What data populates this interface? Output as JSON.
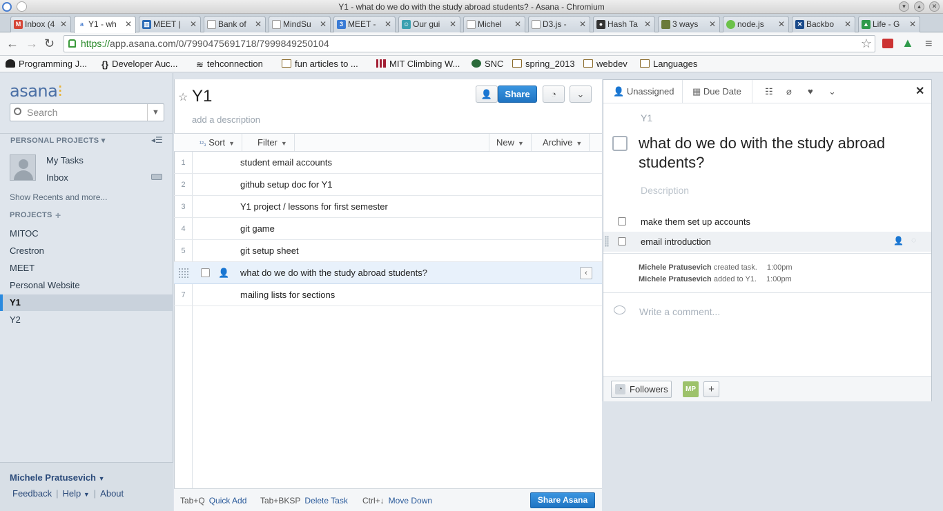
{
  "window": {
    "title": "Y1 - what do we do with the study abroad students? - Asana - Chromium"
  },
  "tabs": [
    {
      "label": "Inbox (4",
      "icon": "gmail-icon",
      "color": "#d44638"
    },
    {
      "label": "Y1 - wh",
      "icon": "asana-icon",
      "color": "#4a7fd0"
    },
    {
      "label": "MEET |",
      "icon": "trello-icon",
      "color": "#2a6ab5"
    },
    {
      "label": "Bank of",
      "icon": "document-icon",
      "color": "#888888"
    },
    {
      "label": "MindSu",
      "icon": "document-icon",
      "color": "#888888"
    },
    {
      "label": "MEET -",
      "icon": "calendar-icon",
      "color": "#3a7bd5"
    },
    {
      "label": "Our gui",
      "icon": "person-icon",
      "color": "#3aa0b0"
    },
    {
      "label": "Michel",
      "icon": "document-icon",
      "color": "#888888"
    },
    {
      "label": "D3.js -",
      "icon": "document-icon",
      "color": "#888888"
    },
    {
      "label": "Hash Ta",
      "icon": "github-icon",
      "color": "#333333"
    },
    {
      "label": "3 ways",
      "icon": "image-icon",
      "color": "#6a7a3a"
    },
    {
      "label": "node.js",
      "icon": "nodejs-icon",
      "color": "#6cc24a"
    },
    {
      "label": "Backbo",
      "icon": "backbone-icon",
      "color": "#1a4a8a"
    },
    {
      "label": "Life - G",
      "icon": "drive-icon",
      "color": "#2e9a4a"
    }
  ],
  "address": {
    "scheme": "https://",
    "rest": "app.asana.com/0/7990475691718/7999849250104"
  },
  "bookmarks": [
    {
      "label": "Programming J...",
      "icon": "spy-icon"
    },
    {
      "label": "Developer Auc...",
      "icon": "braces-icon"
    },
    {
      "label": "tehconnection",
      "icon": "wifi-icon"
    },
    {
      "label": "fun articles to ...",
      "icon": "folder-icon"
    },
    {
      "label": "MIT Climbing W...",
      "icon": "mit-icon"
    },
    {
      "label": "SNC",
      "icon": "snc-icon"
    },
    {
      "label": "spring_2013",
      "icon": "folder-icon"
    },
    {
      "label": "webdev",
      "icon": "folder-icon"
    },
    {
      "label": "Languages",
      "icon": "folder-icon"
    }
  ],
  "sidebar": {
    "logo": "asana",
    "search_placeholder": "Search",
    "personal_projects": "PERSONAL PROJECTS",
    "my_tasks": "My Tasks",
    "inbox": "Inbox",
    "show_recents": "Show Recents and more...",
    "projects_head": "PROJECTS",
    "projects": [
      "MITOC",
      "Crestron",
      "MEET",
      "Personal Website",
      "Y1",
      "Y2"
    ],
    "selected_project": "Y1",
    "user": "Michele Pratusevich",
    "feedback": "Feedback",
    "help": "Help",
    "about": "About"
  },
  "project": {
    "title": "Y1",
    "desc_placeholder": "add a description",
    "share": "Share",
    "sort": "Sort",
    "filter": "Filter",
    "new": "New",
    "archive": "Archive",
    "tasks": [
      {
        "num": "1",
        "text": "student email accounts"
      },
      {
        "num": "2",
        "text": "github setup doc for Y1"
      },
      {
        "num": "3",
        "text": "Y1 project / lessons for first semester"
      },
      {
        "num": "4",
        "text": "git game"
      },
      {
        "num": "5",
        "text": "git setup sheet"
      },
      {
        "num": "",
        "text": "what do we do with the study abroad students?"
      },
      {
        "num": "7",
        "text": "mailing lists for sections"
      }
    ]
  },
  "footer": {
    "k1": "Tab+Q",
    "a1": "Quick Add",
    "k2": "Tab+BKSP",
    "a2": "Delete Task",
    "k3": "Ctrl+↓",
    "a3": "Move Down",
    "share_asana": "Share Asana"
  },
  "task": {
    "assignee": "Unassigned",
    "due": "Due Date",
    "project": "Y1",
    "title": "what do we do with the study abroad students?",
    "desc_placeholder": "Description",
    "subtasks": [
      "make them set up accounts",
      "email introduction"
    ],
    "activity": [
      {
        "who": "Michele Pratusevich",
        "what": "created task.",
        "time": "1:00pm"
      },
      {
        "who": "Michele Pratusevich",
        "what": "added to Y1.",
        "time": "1:00pm"
      }
    ],
    "comment_placeholder": "Write a comment...",
    "followers": "Followers",
    "follower_initials": "MP"
  }
}
